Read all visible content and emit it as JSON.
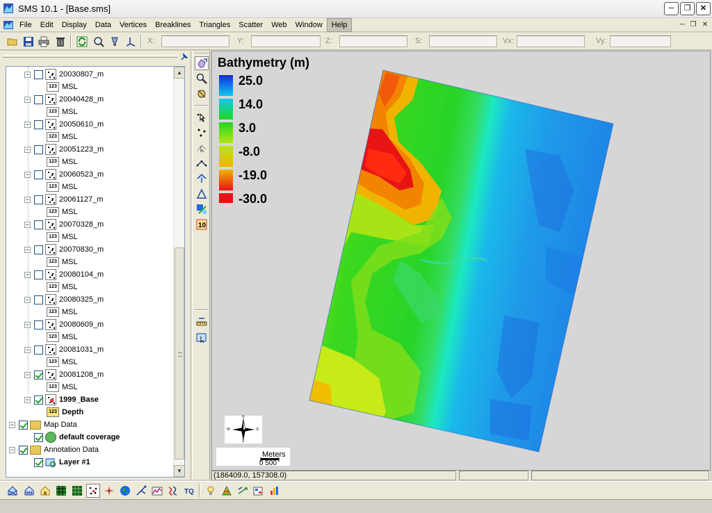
{
  "window": {
    "title": "SMS 10.1 - [Base.sms]"
  },
  "menu": {
    "items": [
      "File",
      "Edit",
      "Display",
      "Data",
      "Vertices",
      "Breaklines",
      "Triangles",
      "Scatter",
      "Web",
      "Window",
      "Help"
    ],
    "active": "Help"
  },
  "toolbar": {
    "coords": [
      {
        "label": "X:"
      },
      {
        "label": "Y:"
      },
      {
        "label": "Z:"
      },
      {
        "label": "S:"
      },
      {
        "label": "Vx:"
      },
      {
        "label": "Vy:"
      }
    ]
  },
  "tree": {
    "datasets": [
      {
        "name": "20030807_m",
        "checked": false,
        "child": "MSL"
      },
      {
        "name": "20040428_m",
        "checked": false,
        "child": "MSL"
      },
      {
        "name": "20050610_m",
        "checked": false,
        "child": "MSL"
      },
      {
        "name": "20051223_m",
        "checked": false,
        "child": "MSL"
      },
      {
        "name": "20060523_m",
        "checked": false,
        "child": "MSL"
      },
      {
        "name": "20061127_m",
        "checked": false,
        "child": "MSL"
      },
      {
        "name": "20070328_m",
        "checked": false,
        "child": "MSL"
      },
      {
        "name": "20070830_m",
        "checked": false,
        "child": "MSL"
      },
      {
        "name": "20080104_m",
        "checked": false,
        "child": "MSL"
      },
      {
        "name": "20080325_m",
        "checked": false,
        "child": "MSL"
      },
      {
        "name": "20080609_m",
        "checked": false,
        "child": "MSL"
      },
      {
        "name": "20081031_m",
        "checked": false,
        "child": "MSL"
      },
      {
        "name": "20081208_m",
        "checked": true,
        "child": "MSL"
      }
    ],
    "base": {
      "name": "1999_Base",
      "child": "Depth"
    },
    "map_data": {
      "label": "Map Data",
      "child": "default coverage"
    },
    "annotation": {
      "label": "Annotation Data",
      "child": "Layer #1"
    }
  },
  "legend": {
    "title": "Bathymetry (m)",
    "entries": [
      {
        "value": "25.0",
        "color": "#1428e6"
      },
      {
        "value": "14.0",
        "color": "#0ec8ec"
      },
      {
        "value": "3.0",
        "color": "#22d622"
      },
      {
        "value": "-8.0",
        "color": "#b4e614"
      },
      {
        "value": "-19.0",
        "color": "#f0b400"
      },
      {
        "value": "-30.0",
        "color": "#e81414"
      }
    ]
  },
  "north_arrow": {
    "n": "N",
    "s": "S",
    "e": "E",
    "w": "W"
  },
  "scale_bar": {
    "unit": "Meters",
    "ticks": "0  500"
  },
  "status": {
    "cursor": "(186409.0, 157308.0)"
  }
}
